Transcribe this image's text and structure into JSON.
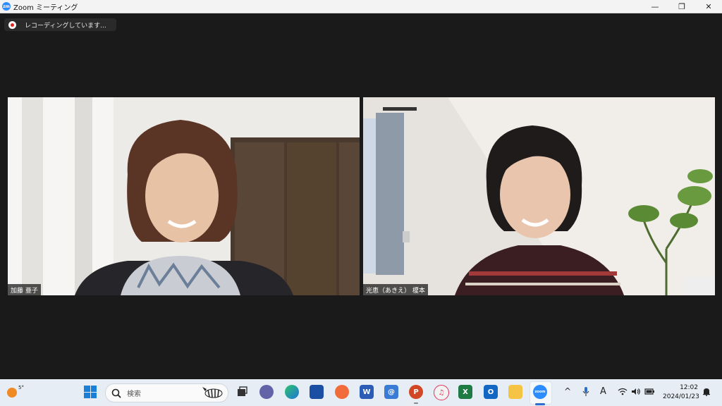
{
  "window": {
    "title": "Zoom ミーティング",
    "logo_text": "zm",
    "controls": {
      "minimize": "—",
      "restore": "❐",
      "close": "✕"
    }
  },
  "meeting": {
    "recording_label": "レコーディングしています...",
    "participants": [
      {
        "name": "加藤 亜子"
      },
      {
        "name": "光恵（あきえ） 榎本"
      }
    ]
  },
  "taskbar": {
    "weather_temp": "5°",
    "search_placeholder": "検索",
    "apps": [
      {
        "name": "task-view",
        "label": ""
      },
      {
        "name": "teams",
        "label": ""
      },
      {
        "name": "edge",
        "label": ""
      },
      {
        "name": "store",
        "label": ""
      },
      {
        "name": "app-orange",
        "label": ""
      },
      {
        "name": "word",
        "label": "W"
      },
      {
        "name": "mail",
        "label": "@"
      },
      {
        "name": "powerpoint",
        "label": "P"
      },
      {
        "name": "itunes",
        "label": "♫"
      },
      {
        "name": "excel",
        "label": "X"
      },
      {
        "name": "outlook",
        "label": "O"
      },
      {
        "name": "file-explorer",
        "label": ""
      },
      {
        "name": "zoom",
        "label": "zoom"
      }
    ],
    "tray": {
      "chevron": "^",
      "ime": "A"
    },
    "time": "12:02",
    "date": "2024/01/23"
  },
  "colors": {
    "meeting_bg": "#1a1a1a",
    "taskbar_bg": "#e6edf5",
    "zoom_blue": "#2d8cff",
    "recording_red": "#e0271f"
  }
}
